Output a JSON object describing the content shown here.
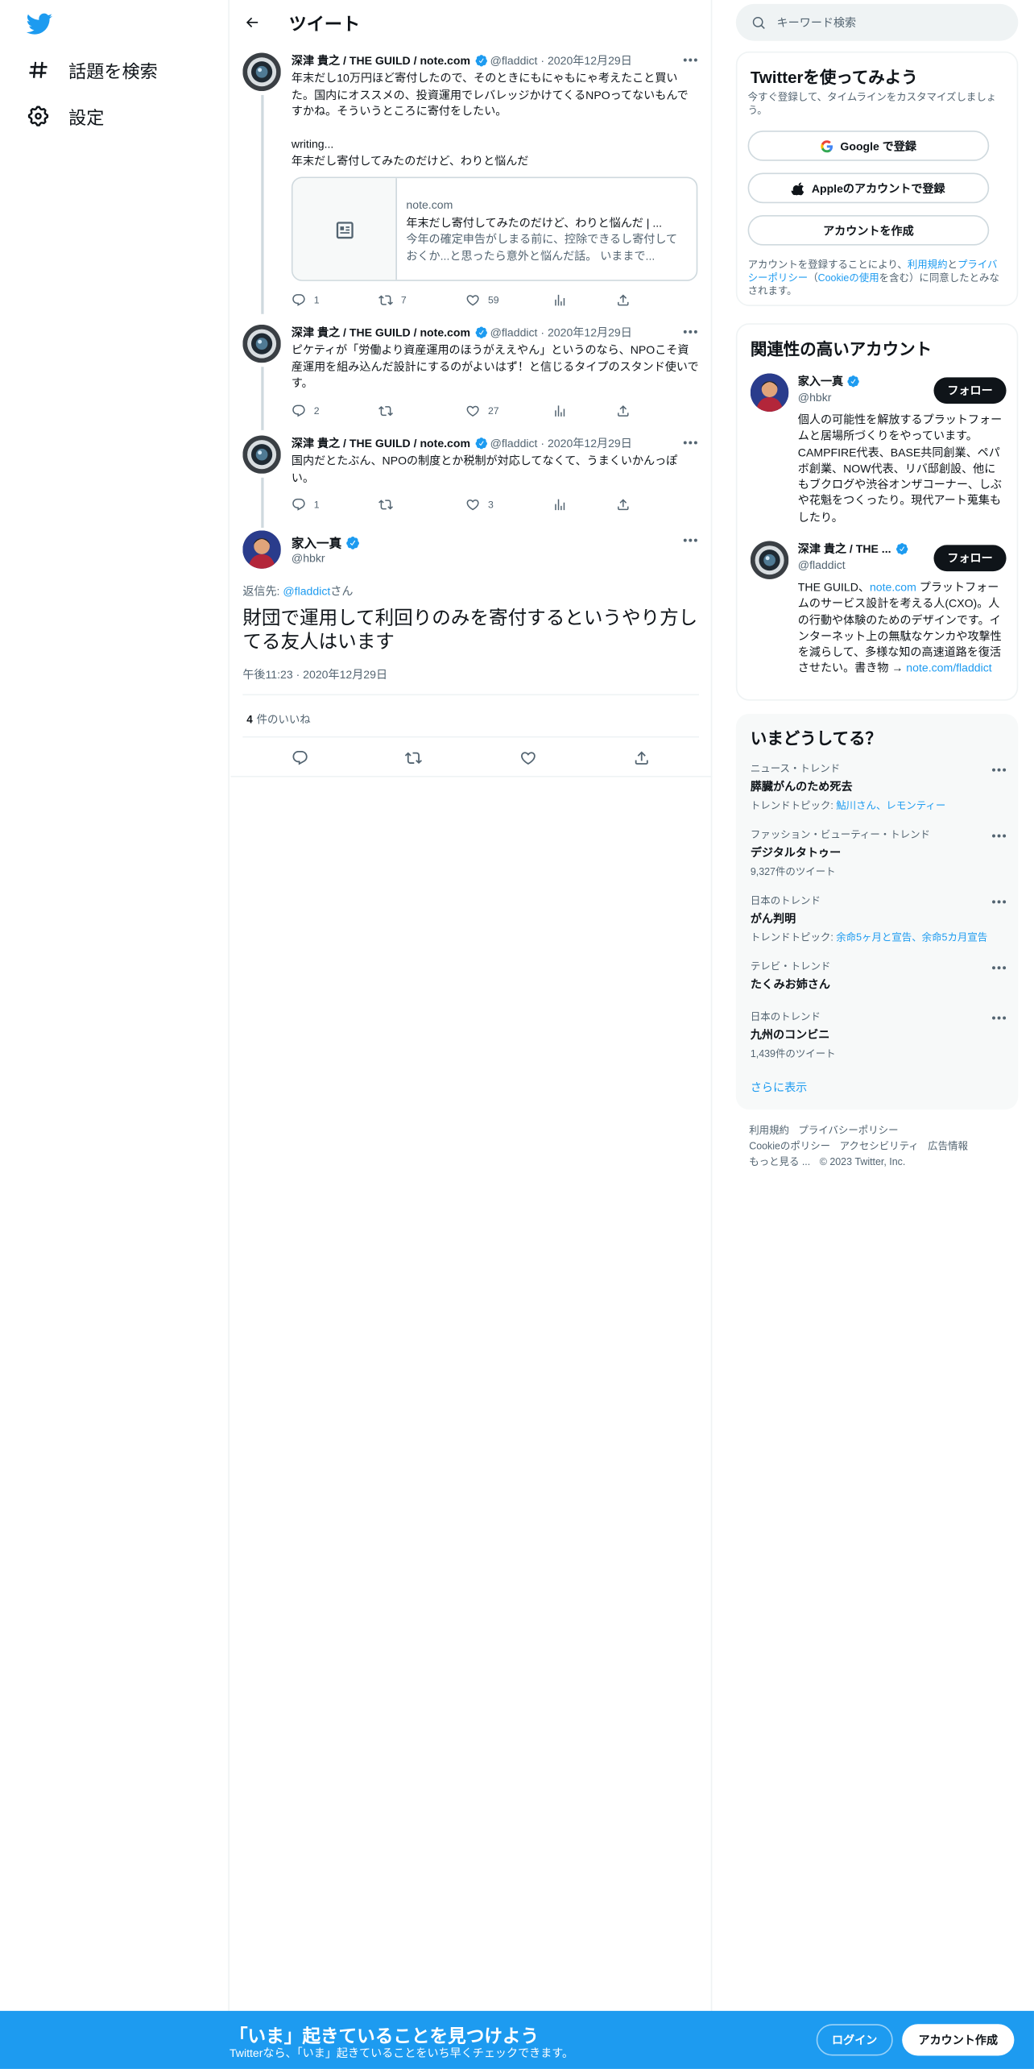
{
  "nav": {
    "items": [
      {
        "label": "話題を検索",
        "icon": "hashtag-icon"
      },
      {
        "label": "設定",
        "icon": "gear-icon"
      }
    ]
  },
  "header": {
    "title": "ツイート"
  },
  "tweets": [
    {
      "name": "深津 貴之 / THE GUILD / note.com",
      "handle": "@fladdict",
      "date": "2020年12月29日",
      "text": "年末だし10万円ほど寄付したので、そのときにもにゃもにゃ考えたこと買いた。国内にオススメの、投資運用でレバレッジかけてくるNPOってないもんですかね。そういうところに寄付をしたい。\n\nwriting...\n年末だし寄付してみたのだけど、わりと悩んだ",
      "card": {
        "domain": "note.com",
        "title": "年末だし寄付してみたのだけど、わりと悩んだ | ...",
        "desc": "今年の確定申告がしまる前に、控除できるし寄付しておくか...と思ったら意外と悩んだ話。 いままで..."
      },
      "replies": "1",
      "retweets": "7",
      "likes": "59"
    },
    {
      "name": "深津 貴之 / THE GUILD / note.com",
      "handle": "@fladdict",
      "date": "2020年12月29日",
      "text": "ピケティが「労働より資産運用のほうがええやん」というのなら、NPOこそ資産運用を組み込んだ設計にするのがよいはず！と信じるタイプのスタンド使いです。",
      "replies": "2",
      "retweets": "",
      "likes": "27"
    },
    {
      "name": "深津 貴之 / THE GUILD / note.com",
      "handle": "@fladdict",
      "date": "2020年12月29日",
      "text": "国内だとたぶん、NPOの制度とか税制が対応してなくて、うまくいかんっぽい。",
      "replies": "1",
      "retweets": "",
      "likes": "3"
    }
  ],
  "focus": {
    "name": "家入一真",
    "handle": "@hbkr",
    "reply_prefix": "返信先: ",
    "reply_to": "@fladdict",
    "reply_suffix": "さん",
    "text": "財団で運用して利回りのみを寄付するというやり方してる友人はいます",
    "time": "午後11:23",
    "date": "2020年12月29日",
    "likes_count": "4",
    "likes_label": "件のいいね"
  },
  "search": {
    "placeholder": "キーワード検索"
  },
  "signup": {
    "title": "Twitterを使ってみよう",
    "subtitle": "今すぐ登録して、タイムラインをカスタマイズしましょう。",
    "google": "Google で登録",
    "apple": "Appleのアカウントで登録",
    "create": "アカウントを作成",
    "legal_1": "アカウントを登録することにより、",
    "legal_link1": "利用規約",
    "legal_2": "と",
    "legal_link2": "プライバシーポリシー",
    "legal_3": "（",
    "legal_link3": "Cookieの使用",
    "legal_4": "を含む）に同意したとみなされます。"
  },
  "related": {
    "title": "関連性の高いアカウント",
    "follow_label": "フォロー",
    "accounts": [
      {
        "name": "家入一真",
        "handle": "@hbkr",
        "bio": "個人の可能性を解放するプラットフォームと居場所づくりをやっています。CAMPFIRE代表、BASE共同創業、ペパボ創業、NOW代表、リバ邸創設、他にもブクログや渋谷オンザコーナー、しぶや花魁をつくったり。現代アート蒐集もしたり。"
      },
      {
        "name": "深津 貴之 / THE ...",
        "handle": "@fladdict",
        "bio_1": "THE GUILD、",
        "bio_link": "note.com",
        "bio_2": " プラットフォームのサービス設計を考える人(CXO)。人の行動や体験のためのデザインです。インターネット上の無駄なケンカや攻撃性を減らして、多様な知の高速道路を復活させたい。書き物 → ",
        "bio_link2": "note.com/fladdict"
      }
    ]
  },
  "trends": {
    "title": "いまどうしてる？",
    "items": [
      {
        "context": "ニュース・トレンド",
        "name": "膵臓がんのため死去",
        "sub_label": "トレンドトピック: ",
        "sub_link": "鮎川さん、レモンティー"
      },
      {
        "context": "ファッション・ビューティー・トレンド",
        "name": "デジタルタトゥー",
        "sub": "9,327件のツイート"
      },
      {
        "context": "日本のトレンド",
        "name": "がん判明",
        "sub_label": "トレンドトピック: ",
        "sub_link": "余命5ヶ月と宣告、余命5カ月宣告"
      },
      {
        "context": "テレビ・トレンド",
        "name": "たくみお姉さん"
      },
      {
        "context": "日本のトレンド",
        "name": "九州のコンビニ",
        "sub": "1,439件のツイート"
      }
    ],
    "show_more": "さらに表示"
  },
  "footer": {
    "links": [
      "利用規約",
      "プライバシーポリシー",
      "Cookieのポリシー",
      "アクセシビリティ",
      "広告情報",
      "もっと見る ..."
    ],
    "copyright": "© 2023 Twitter, Inc."
  },
  "bottom": {
    "title": "「いま」起きていることを見つけよう",
    "subtitle": "Twitterなら、「いま」起きていることをいち早くチェックできます。",
    "login": "ログイン",
    "signup": "アカウント作成"
  },
  "colors": {
    "accent": "#1d9bf0",
    "text": "#0f1419",
    "secondary": "#536471",
    "border": "#eff3f4"
  }
}
